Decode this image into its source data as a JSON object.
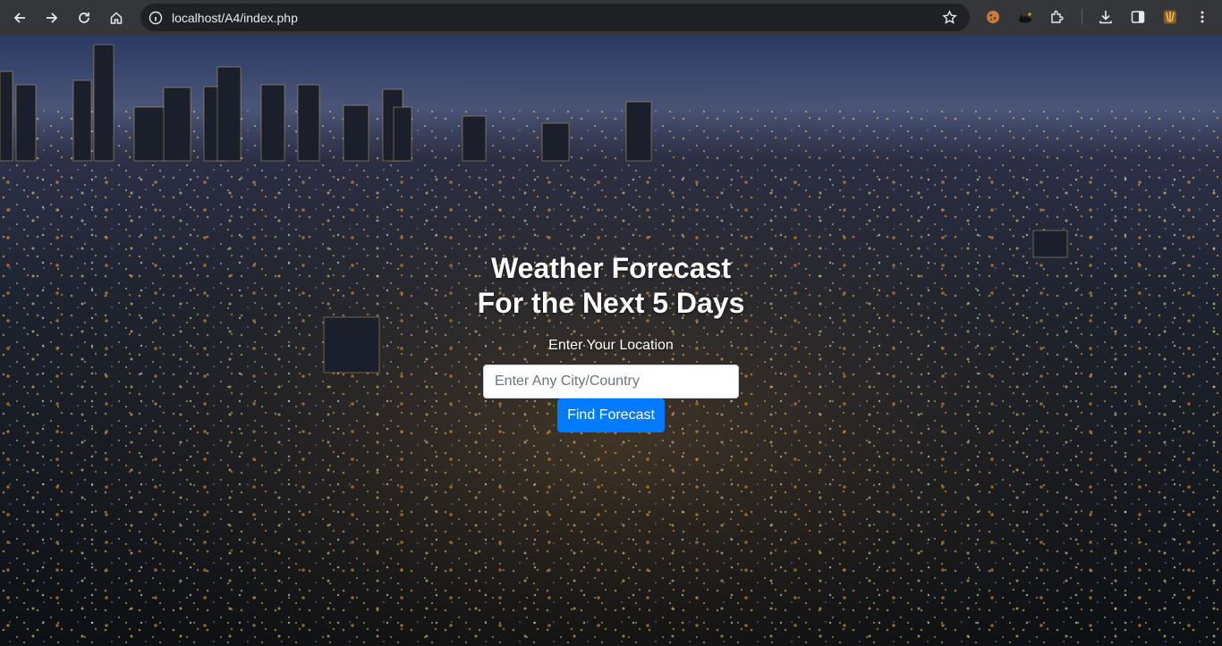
{
  "browser": {
    "url": "localhost/A4/index.php",
    "icons": [
      "back-icon",
      "forward-icon",
      "reload-icon",
      "home-icon",
      "site-info-icon",
      "bookmark-star-icon",
      "cookie-extension-icon",
      "cat-extension-icon",
      "extensions-puzzle-icon",
      "download-icon",
      "side-panel-icon",
      "profile-avatar-icon",
      "menu-kebab-icon"
    ]
  },
  "hero": {
    "title_line1": "Weather Forecast",
    "title_line2": "For the Next 5 Days",
    "location_label": "Enter Your Location",
    "location_placeholder": "Enter Any City/Country",
    "location_value": "",
    "submit_label": "Find Forecast",
    "button_color": "#007bff",
    "background": "night-city-skyline-photo"
  }
}
